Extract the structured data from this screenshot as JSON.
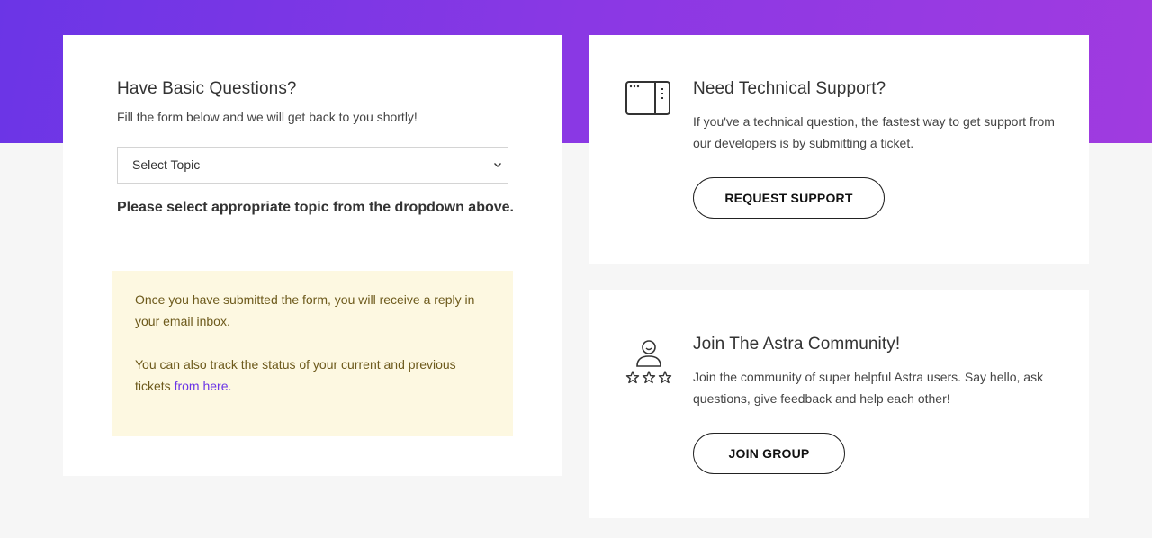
{
  "basic_questions": {
    "title": "Have Basic Questions?",
    "subtitle": "Fill the form below and we will get back to you shortly!",
    "topic_select": {
      "selected": "Select Topic"
    },
    "hint": "Please select appropriate topic from the dropdown above.",
    "notice": {
      "line1": "Once you have submitted the form, you will receive a reply in your email inbox.",
      "line2_prefix": "You can also track the status of your current and previous tickets ",
      "line2_link": "from here."
    }
  },
  "technical_support": {
    "icon": "window-panel-icon",
    "title": "Need Technical Support?",
    "description": "If you've a technical question, the fastest way to get support from our developers is by submitting a ticket.",
    "button_label": "REQUEST SUPPORT"
  },
  "community": {
    "icon": "user-rating-icon",
    "title": "Join The Astra Community!",
    "description": "Join the community of super helpful Astra users. Say hello, ask questions, give feedback and help each other!",
    "button_label": "JOIN GROUP"
  },
  "colors": {
    "hero_gradient_start": "#6b35e6",
    "hero_gradient_end": "#a03be0",
    "link": "#6b35e6",
    "notice_bg": "#fdf8e1",
    "notice_text": "#6d5a1c"
  }
}
